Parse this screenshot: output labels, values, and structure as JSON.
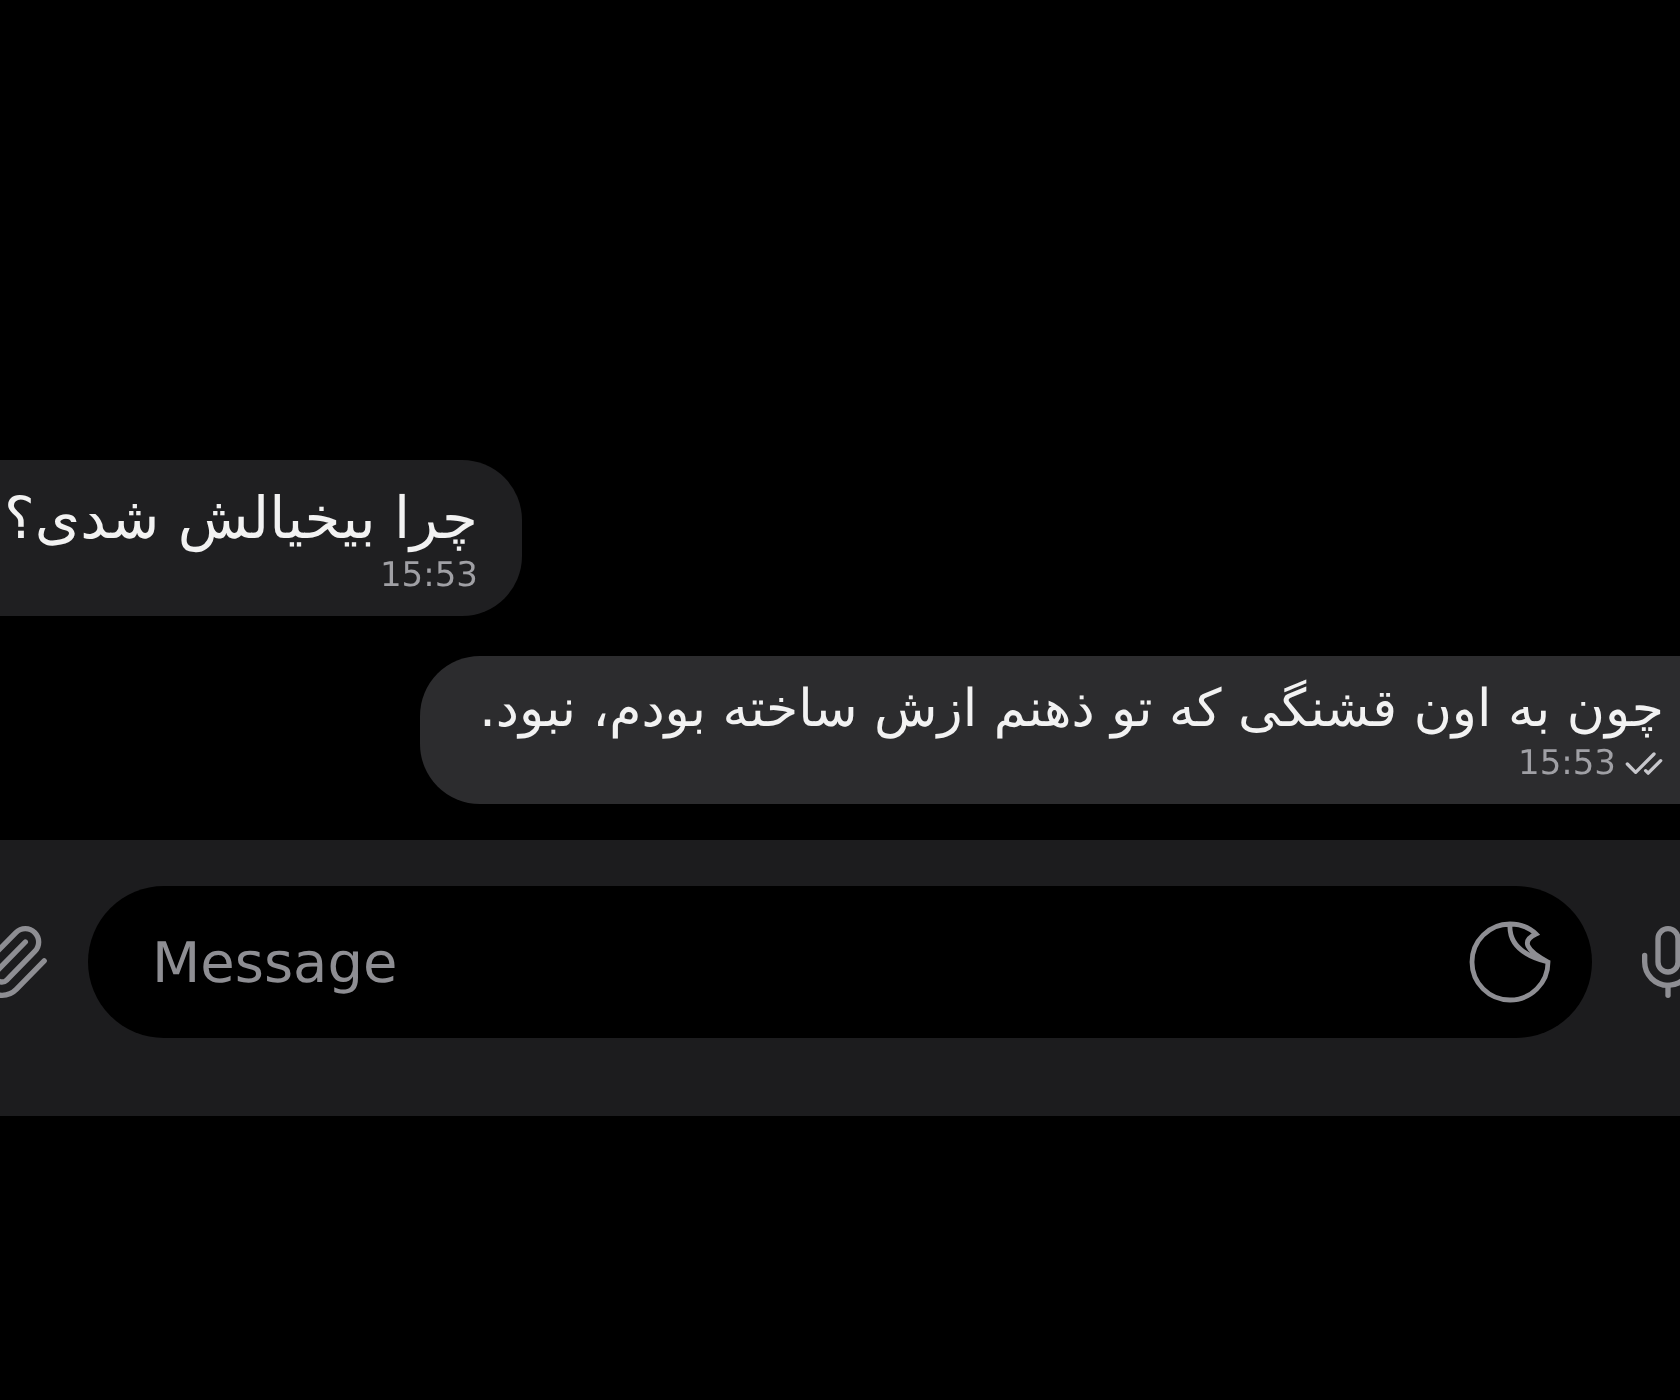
{
  "messages": [
    {
      "kind": "incoming",
      "text": "چرا بیخیالش شدی؟",
      "time": "15:53"
    },
    {
      "kind": "outgoing",
      "text": "چون به اون قشنگی که تو ذهنم ازش ساخته بودم، نبود.",
      "time": "15:53",
      "read": true
    }
  ],
  "composer": {
    "placeholder": "Message"
  }
}
